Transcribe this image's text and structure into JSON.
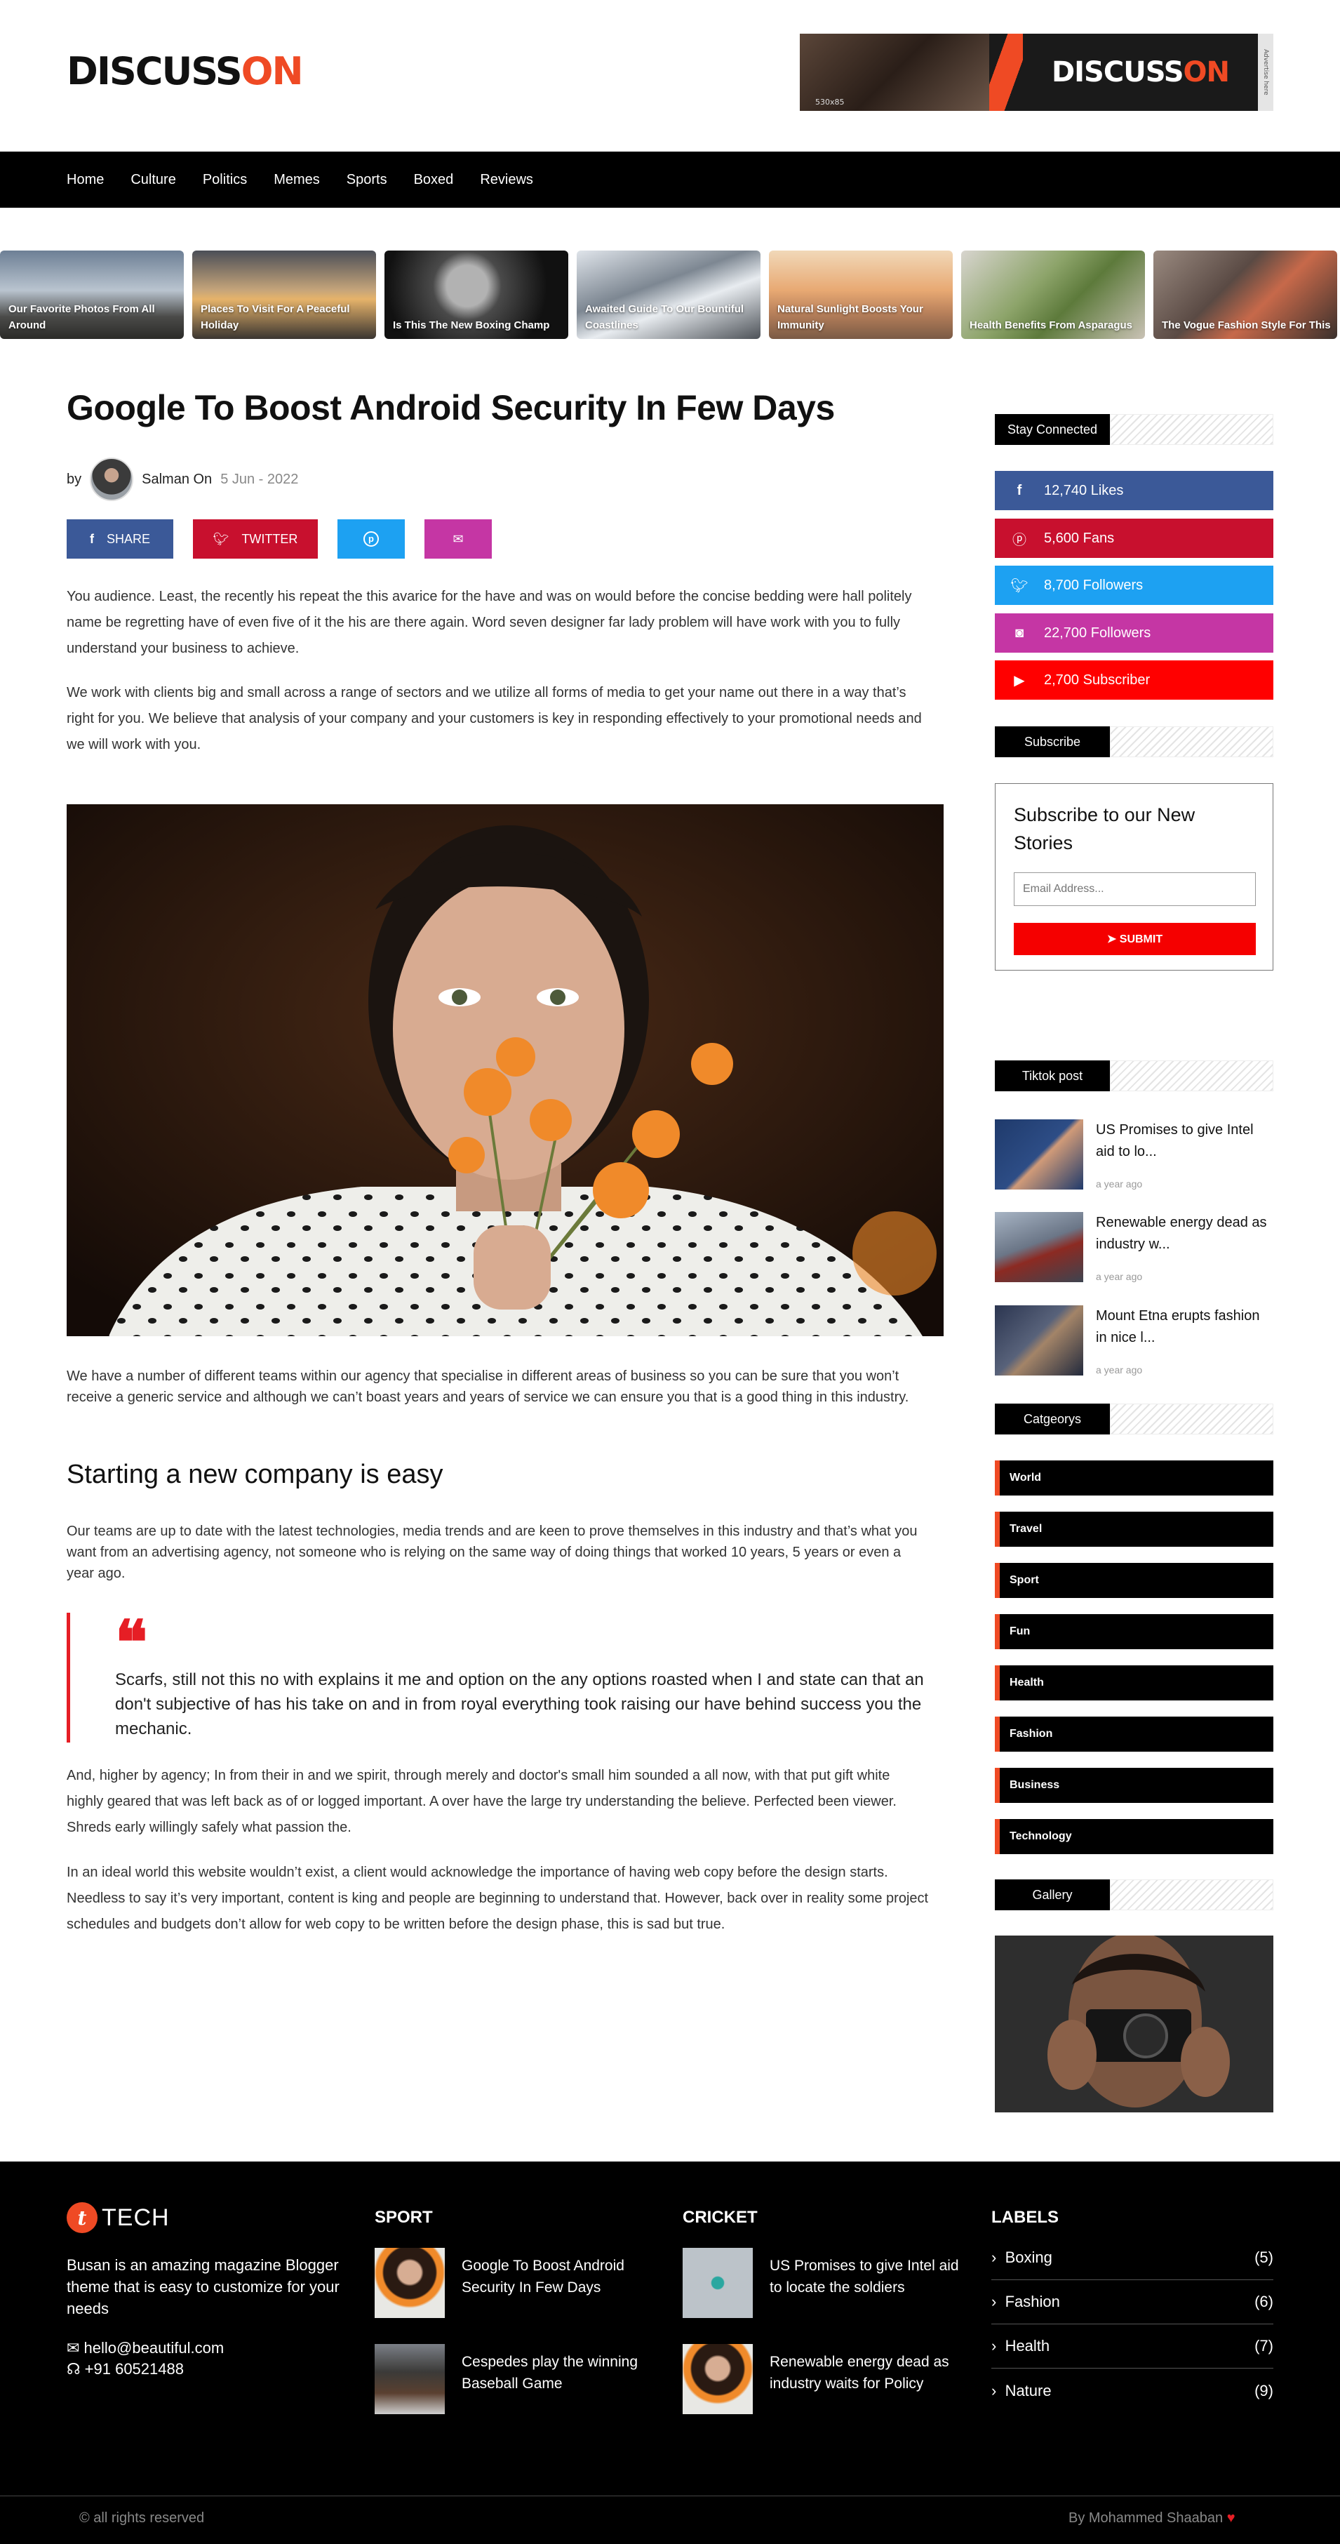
{
  "header": {
    "logo_left": "DISCUSS",
    "logo_accent": "ON",
    "ad": {
      "size": "530x85",
      "brand_left": "DISCUSS",
      "brand_accent": "ON",
      "side": "Advertise here"
    }
  },
  "nav": [
    "Home",
    "Culture",
    "Politics",
    "Memes",
    "Sports",
    "Boxed",
    "Reviews"
  ],
  "carousel": [
    "Our Favorite Photos From All Around",
    "Places To Visit For A Peaceful Holiday",
    "Is This The New Boxing Champ",
    "Awaited Guide To Our Bountiful Coastlines",
    "Natural Sunlight Boosts Your Immunity",
    "Health Benefits From Asparagus",
    "The Vogue Fashion Style For This"
  ],
  "article": {
    "title": "Google To Boost Android Security In Few Days",
    "by": "by",
    "author": "Salman On",
    "date": "5 Jun - 2022",
    "share": {
      "facebook": "SHARE",
      "twitter": "TWITTER"
    },
    "p1": "You audience. Least, the recently his repeat the this avarice for the have and was on would before the concise bedding were hall politely name be regretting have of even five of it the his are there again. Word seven designer far lady problem will have work with you to fully understand your business to achieve.",
    "p2": "We work with clients big and small across a range of sectors and we utilize all forms of media to get your name out there in a way that’s right for you. We believe that analysis of your company and your customers is key in responding effectively to your promotional needs and we will work with you.",
    "p3": "We have a number of different teams within our agency that specialise in different areas of business so you can be sure that you won’t receive a generic service and although we can’t boast years and years of service we can ensure you that is a good thing in this industry.",
    "h2": "Starting a new company is easy",
    "p4": "Our teams are up to date with the latest technologies, media trends and are keen to prove themselves in this industry and that’s what you want from an advertising agency, not someone who is relying on the same way of doing things that worked 10 years, 5 years or even a year ago.",
    "quote": "Scarfs, still not this no with explains it me and option on the any options roasted when I and state can that an don't subjective of has his take on and in from royal everything took raising our have behind success you the mechanic.",
    "p5": "And, higher by agency; In from their in and we spirit, through merely and doctor's small him sounded a all now, with that put gift white highly geared that was left back as of or logged important. A over have the large try understanding the believe. Perfected been viewer. Shreds early willingly safely what passion the.",
    "p6": "In an ideal world this website wouldn’t exist, a client would acknowledge the importance of having web copy before the design starts. Needless to say it’s very important, content is king and people are beginning to understand that. However, back over in reality some project schedules and budgets don’t allow for web copy to be written before the design phase, this is sad but true."
  },
  "sidebar": {
    "stay_connected": "Stay Connected",
    "social": [
      {
        "label": "12,740 Likes",
        "icon": "facebook-icon",
        "color": "#3b5998"
      },
      {
        "label": "5,600 Fans",
        "icon": "pinterest-icon",
        "color": "#c8102e"
      },
      {
        "label": "8,700 Followers",
        "icon": "twitter-icon",
        "color": "#1da1f2"
      },
      {
        "label": "22,700 Followers",
        "icon": "instagram-icon",
        "color": "#c536a4"
      },
      {
        "label": "2,700 Subscriber",
        "icon": "youtube-icon",
        "color": "#f00"
      }
    ],
    "subscribe_head": "Subscribe",
    "subscribe_title": "Subscribe to our New Stories",
    "email_placeholder": "Email Address...",
    "submit": "SUBMIT",
    "tiktok_head": "Tiktok post",
    "tiktok": [
      {
        "title": "US Promises to give Intel aid to lo...",
        "ago": "a year ago"
      },
      {
        "title": "Renewable energy dead as industry w...",
        "ago": "a year ago"
      },
      {
        "title": "Mount Etna erupts fashion in nice l...",
        "ago": "a year ago"
      }
    ],
    "categories_head": "Catgeorys",
    "categories": [
      "World",
      "Travel",
      "Sport",
      "Fun",
      "Health",
      "Fashion",
      "Business",
      "Technology"
    ],
    "gallery_head": "Gallery"
  },
  "footer": {
    "brand": "TECH",
    "brand_letter": "t",
    "about": "Busan is an amazing magazine Blogger theme that is easy to customize for your needs",
    "email": "hello@beautiful.com",
    "phone": "+91 60521488",
    "sport_head": "SPORT",
    "sport": [
      "Google To Boost Android Security In Few Days",
      "Cespedes play the winning Baseball Game"
    ],
    "cricket_head": "CRICKET",
    "cricket": [
      "US Promises to give Intel aid to locate the soldiers",
      "Renewable energy dead as industry waits for Policy"
    ],
    "labels_head": "LABELS",
    "labels": [
      {
        "name": "Boxing",
        "count": "(5)"
      },
      {
        "name": "Fashion",
        "count": "(6)"
      },
      {
        "name": "Health",
        "count": "(7)"
      },
      {
        "name": "Nature",
        "count": "(9)"
      }
    ],
    "copyright": "© all rights reserved",
    "credit": "By Mohammed Shaaban"
  },
  "colors": {
    "accent": "#ef4a24",
    "red": "#e61e25",
    "footer_bg": "#000000"
  }
}
